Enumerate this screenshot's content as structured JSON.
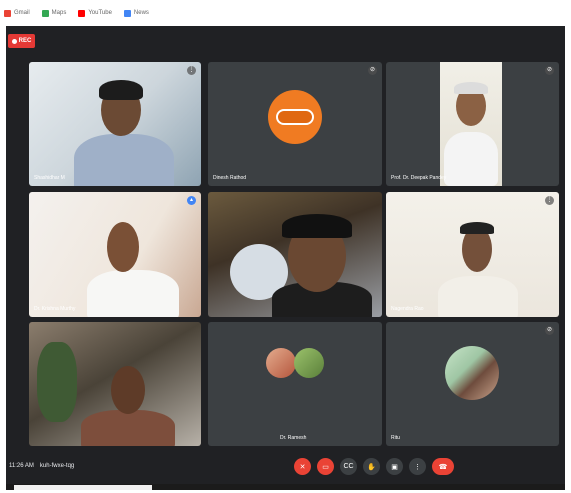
{
  "browser": {
    "bookmarks": [
      {
        "label": "Gmail",
        "color": "#ea4335"
      },
      {
        "label": "Maps",
        "color": "#34a853"
      },
      {
        "label": "YouTube",
        "color": "#ff0000"
      },
      {
        "label": "News",
        "color": "#4285f4"
      }
    ]
  },
  "meeting": {
    "recording_label": "REC",
    "participants": [
      {
        "name": "Shashidhar M"
      },
      {
        "name": "Dinesh Rathod"
      },
      {
        "name": "Prof. Dr. Deepak Pandey"
      },
      {
        "name": "Dr. Krishna Murthy"
      },
      {
        "name": ""
      },
      {
        "name": "Nagendra Rao"
      },
      {
        "name": ""
      },
      {
        "name": "Dr. Ramesh"
      },
      {
        "name": "Ritu"
      }
    ],
    "meeting_time": "11:26 AM",
    "meeting_code": "kuh-fwxe-tqg"
  },
  "controls": {
    "mic_icon": "mic-off-icon",
    "camera_icon": "camera-icon",
    "captions_icon": "captions-icon",
    "hand_icon": "raise-hand-icon",
    "present_icon": "present-icon",
    "more_icon": "more-options-icon",
    "end_icon": "end-call-icon"
  }
}
